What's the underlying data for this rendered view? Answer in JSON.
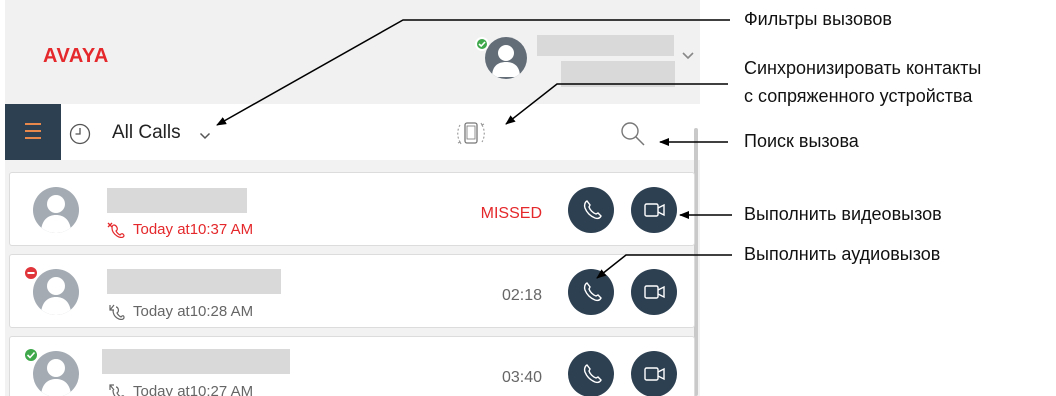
{
  "app": {
    "logo_text": "AVAYA",
    "profile": {
      "status": "available",
      "status_color": "#3ea84b"
    },
    "toolbar": {
      "filter_label": "All Calls",
      "icons": [
        "menu-icon",
        "history-icon",
        "chevron-down-icon",
        "sync-device-icon",
        "search-icon"
      ]
    },
    "calls": [
      {
        "time": "Today at10:37 AM",
        "status": "MISSED",
        "direction": "missed",
        "contact_status": "none"
      },
      {
        "time": "Today at10:28 AM",
        "status": "02:18",
        "direction": "incoming",
        "contact_status": "busy"
      },
      {
        "time": "Today at10:27 AM",
        "status": "03:40",
        "direction": "outgoing",
        "contact_status": "available"
      }
    ],
    "colors": {
      "brand_red": "#e4282b",
      "dark_button": "#2d4052",
      "missed": "#e4282b",
      "available": "#3ea84b",
      "busy": "#e0353a"
    }
  },
  "annotations": {
    "filters": "Фильтры вызовов",
    "sync_line1": "Синхронизировать контакты",
    "sync_line2": "с сопряженного устройства",
    "search": "Поиск вызова",
    "video": "Выполнить видеовызов",
    "audio": "Выполнить аудиовызов"
  }
}
